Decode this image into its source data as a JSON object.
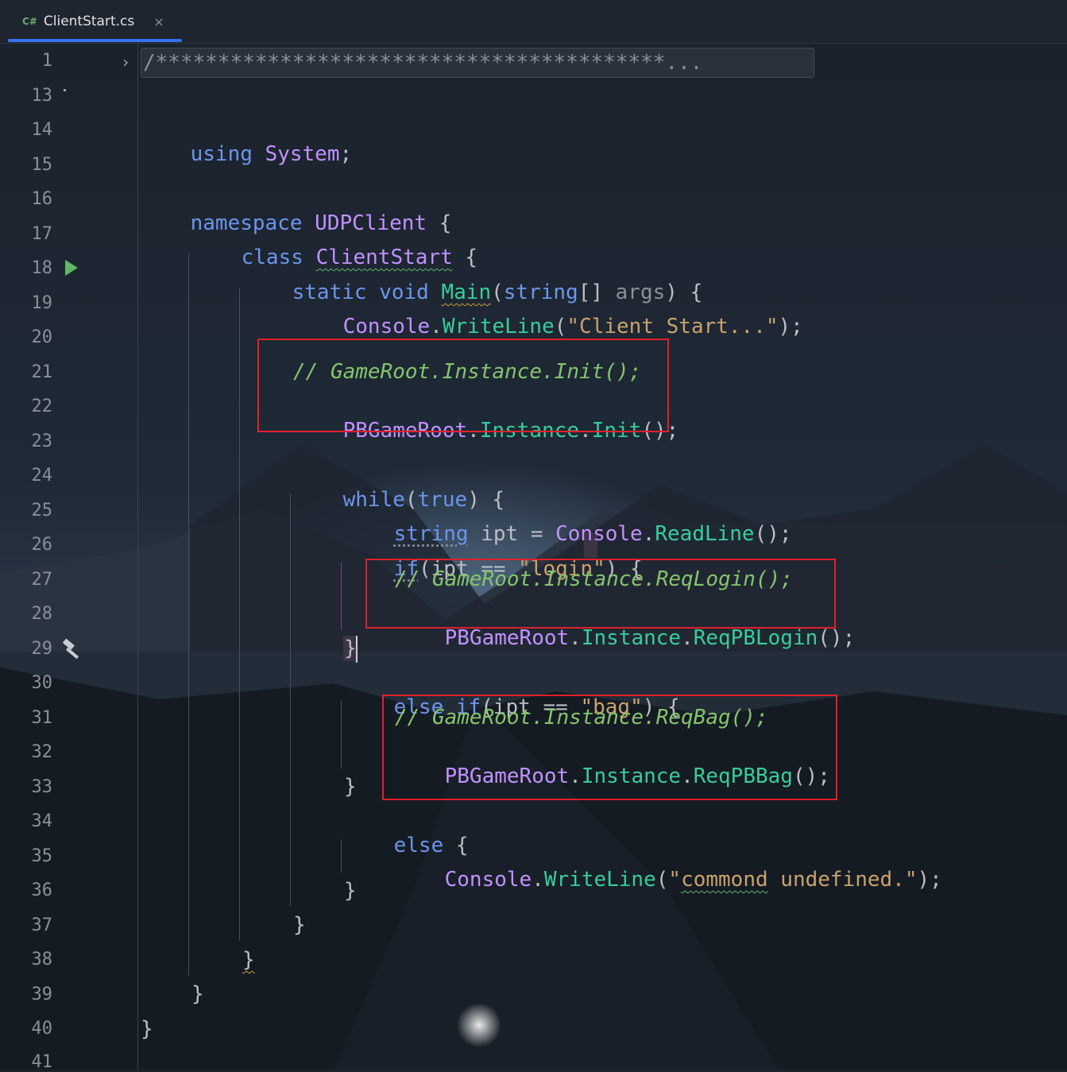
{
  "tab": {
    "lang_badge": "C#",
    "filename": "ClientStart.cs",
    "close_glyph": "×"
  },
  "line_numbers": [
    "1",
    "13",
    "14",
    "15",
    "16",
    "17",
    "18",
    "19",
    "20",
    "21",
    "22",
    "23",
    "24",
    "25",
    "26",
    "27",
    "28",
    "29",
    "30",
    "31",
    "32",
    "33",
    "34",
    "35",
    "36",
    "37",
    "38",
    "39",
    "40",
    "41"
  ],
  "folded_header": "/*****************************************...",
  "code": {
    "l14": {
      "kw": "using",
      "ns": "System",
      "end": ";"
    },
    "l16": {
      "kw": "namespace",
      "name": "UDPClient",
      "end": " {"
    },
    "l17": {
      "kw": "class",
      "name": "ClientStart",
      "end": " {"
    },
    "l18": {
      "kw1": "static",
      "kw2": "void",
      "method": "Main",
      "open": "(",
      "type": "string",
      "mid": "[] ",
      "param": "args",
      "end": ") {"
    },
    "l19": {
      "type": "Console",
      "dot": ".",
      "method": "WriteLine",
      "open": "(",
      "str": "\"Client Start...\"",
      "end": ");"
    },
    "l21": {
      "comment": "// GameRoot.Instance.Init();"
    },
    "l22": {
      "type": "PBGameRoot",
      "dot1": ".",
      "prop": "Instance",
      "dot2": ".",
      "method": "Init",
      "end": "();"
    },
    "l24": {
      "kw": "while",
      "open": "(",
      "val": "true",
      "end": ") {"
    },
    "l25": {
      "type": "string",
      "mid": " ipt = ",
      "cls": "Console",
      "dot": ".",
      "method": "ReadLine",
      "end": "();"
    },
    "l26": {
      "kw": "if",
      "mid": "(ipt == ",
      "str": "\"login\"",
      "end": ") {"
    },
    "l27": {
      "comment": "// GameRoot.Instance.ReqLogin();"
    },
    "l28": {
      "type": "PBGameRoot",
      "dot1": ".",
      "prop": "Instance",
      "dot2": ".",
      "method": "ReqPBLogin",
      "end": "();"
    },
    "l29": {
      "text": "}"
    },
    "l30": {
      "kw1": "else",
      "kw2": "if",
      "mid": "(ipt == ",
      "str": "\"bag\"",
      "end": ") {"
    },
    "l31": {
      "comment": "// GameRoot.Instance.ReqBag();"
    },
    "l32": {
      "type": "PBGameRoot",
      "dot1": ".",
      "prop": "Instance",
      "dot2": ".",
      "method": "ReqPBBag",
      "end": "();"
    },
    "l33": {
      "text": "}"
    },
    "l34": {
      "kw": "else",
      "end": " {"
    },
    "l35": {
      "type": "Console",
      "dot": ".",
      "method": "WriteLine",
      "open": "(",
      "str1": "\"",
      "str2": "commond",
      "str3": " undefined.\"",
      "end": ");"
    },
    "l36": {
      "text": "}"
    },
    "l37": {
      "text": "}"
    },
    "l38": {
      "text": "}"
    },
    "l39": {
      "text": "}"
    },
    "l40": {
      "text": "}"
    }
  },
  "colors": {
    "accent": "#3574f0",
    "highlight_box": "#e0202a",
    "comment": "#85c46c",
    "keyword": "#6c95eb",
    "type": "#c191ff",
    "method": "#39cc9b",
    "string": "#c9a26d"
  }
}
